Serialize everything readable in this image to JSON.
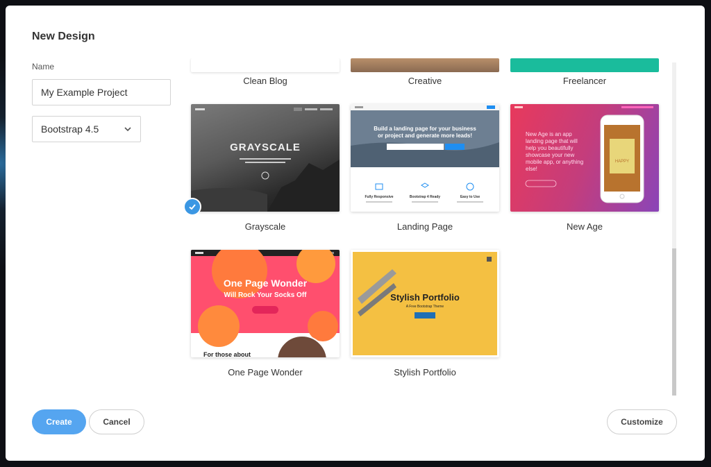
{
  "dialog": {
    "title": "New Design",
    "name_label": "Name",
    "name_value": "My Example Project",
    "framework": "Bootstrap 4.5"
  },
  "templates_top_partial": [
    {
      "label": "Clean Blog"
    },
    {
      "label": "Creative"
    },
    {
      "label": "Freelancer"
    }
  ],
  "templates": [
    {
      "label": "Grayscale",
      "selected": false
    },
    {
      "label": "Landing Page",
      "selected": false
    },
    {
      "label": "New Age",
      "selected": false
    },
    {
      "label": "One Page Wonder",
      "selected": false
    },
    {
      "label": "Stylish Portfolio",
      "selected": true
    }
  ],
  "previews": {
    "grayscale": {
      "heading": "GRAYSCALE"
    },
    "landing": {
      "heading1": "Build a landing page for your business",
      "heading2": "or project and generate more leads!",
      "f1": "Fully Responsive",
      "f2": "Bootstrap 4 Ready",
      "f3": "Easy to Use"
    },
    "newage": {
      "line1": "New Age is an app",
      "line2": "landing page that will",
      "line3": "help you beautifully",
      "line4": "showcase your new",
      "line5": "mobile app, or anything",
      "line6": "else!",
      "phone_text": "HAPPY"
    },
    "onepage": {
      "heading1": "One Page Wonder",
      "heading2": "Will Rock Your Socks Off",
      "footer": "For those about"
    },
    "stylish": {
      "heading": "Stylish Portfolio",
      "sub": "A Free Bootstrap Theme"
    }
  },
  "buttons": {
    "create": "Create",
    "cancel": "Cancel",
    "customize": "Customize"
  },
  "colors": {
    "primary": "#55a5f0",
    "freelancer": "#1abc9c",
    "newage_start": "#e8395c",
    "newage_end": "#8a45b8",
    "onepage": "#ff4f6e",
    "stylish": "#f4c042"
  }
}
